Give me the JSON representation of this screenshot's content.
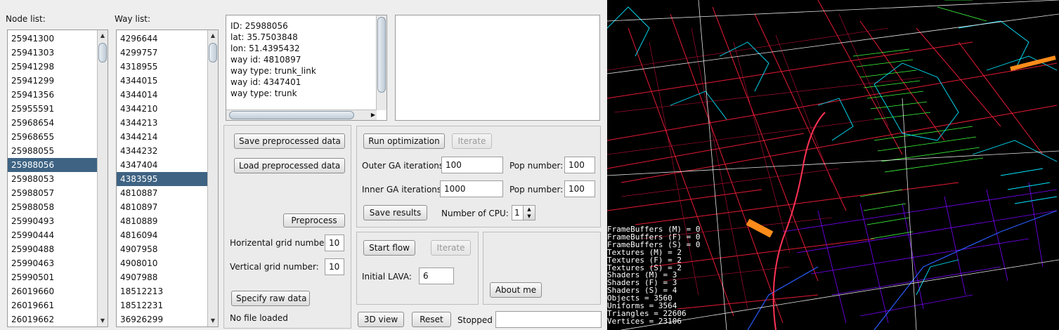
{
  "node_list": {
    "label": "Node list:",
    "items": [
      "25941300",
      "25941303",
      "25941298",
      "25941299",
      "25941356",
      "25955591",
      "25968654",
      "25968655",
      "25988055",
      "25988056",
      "25988053",
      "25988057",
      "25988058",
      "25990493",
      "25990444",
      "25990488",
      "25990463",
      "25990501",
      "26019660",
      "26019661",
      "26019662"
    ],
    "selected_index": 9
  },
  "way_list": {
    "label": "Way list:",
    "items": [
      "4296644",
      "4299757",
      "4318955",
      "4344015",
      "4344014",
      "4344210",
      "4344213",
      "4344214",
      "4344232",
      "4347404",
      "4383595",
      "4810887",
      "4810897",
      "4810889",
      "4816094",
      "4907958",
      "4908010",
      "4907988",
      "18512213",
      "18512231",
      "36926299"
    ],
    "selected_index": 10
  },
  "info": {
    "lines": [
      "ID: 25988056",
      "lat: 35.7503848",
      "lon: 51.4395432",
      "way id: 4810897",
      "way type: trunk_link",
      "way id: 4347401",
      "way type: trunk"
    ]
  },
  "preprocess": {
    "save_label": "Save preprocessed data",
    "load_label": "Load preprocessed data",
    "preprocess_label": "Preprocess",
    "h_grid_label": "Horizental grid number:",
    "h_grid_value": "10",
    "v_grid_label": "Vertical grid number:",
    "v_grid_value": "10",
    "raw_label": "Specify raw data",
    "status": "No file loaded"
  },
  "optimization": {
    "run_label": "Run optimization",
    "iterate_label": "Iterate",
    "outer_label": "Outer GA iterations:",
    "outer_value": "100",
    "outer_pop_label": "Pop number:",
    "outer_pop_value": "100",
    "inner_label": "Inner GA iterations:",
    "inner_value": "1000",
    "inner_pop_label": "Pop number:",
    "inner_pop_value": "100",
    "save_results_label": "Save results",
    "cpu_label": "Number of CPU:",
    "cpu_value": "1"
  },
  "flow": {
    "start_label": "Start flow",
    "iterate_label": "Iterate",
    "lava_label": "Initial LAVA:",
    "lava_value": "6"
  },
  "about_label": "About me",
  "bottom": {
    "view3d_label": "3D view",
    "reset_label": "Reset",
    "status": "Stopped"
  },
  "gl_stats": [
    "FrameBuffers (M) = 0",
    "FrameBuffers (F) = 0",
    "FrameBuffers (S) = 0",
    "Textures (M) = 2",
    "Textures (F) = 2",
    "Textures (S) = 2",
    "Shaders (M) = 3",
    "Shaders (F) = 3",
    "Shaders (S) = 4",
    "Objects = 3560",
    "Uniforms = 3564",
    "Triangles = 22606",
    "Vertices = 23106"
  ],
  "colors": {
    "selection": "#3e6383",
    "highlight_road": "#ff8c1a"
  }
}
